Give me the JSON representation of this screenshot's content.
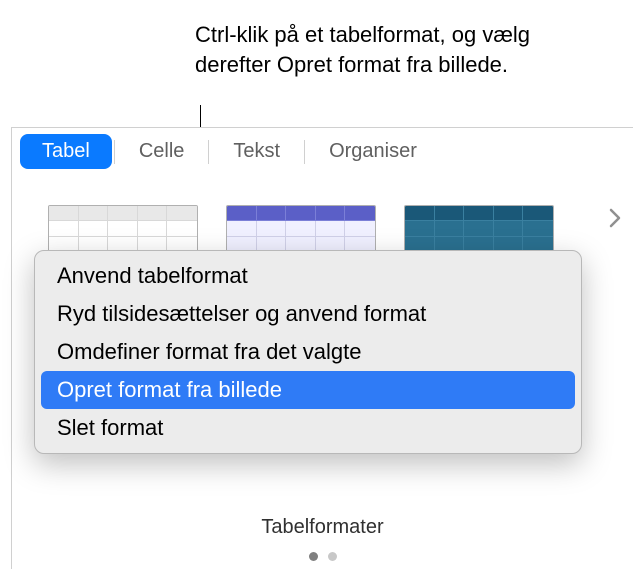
{
  "callout": {
    "text": "Ctrl-klik på et tabelformat, og vælg derefter Opret format fra billede."
  },
  "tabs": {
    "items": [
      {
        "label": "Tabel",
        "active": true
      },
      {
        "label": "Celle",
        "active": false
      },
      {
        "label": "Tekst",
        "active": false
      },
      {
        "label": "Organiser",
        "active": false
      }
    ]
  },
  "contextMenu": {
    "items": [
      {
        "label": "Anvend tabelformat",
        "highlighted": false
      },
      {
        "label": "Ryd tilsidesættelser og anvend format",
        "highlighted": false
      },
      {
        "label": "Omdefiner format fra det valgte",
        "highlighted": false
      },
      {
        "label": "Opret format fra billede",
        "highlighted": true
      },
      {
        "label": "Slet format",
        "highlighted": false
      }
    ]
  },
  "footer": {
    "label": "Tabelformater"
  },
  "colors": {
    "accent": "#0a7aff",
    "menuHighlight": "#2f7bf6"
  }
}
